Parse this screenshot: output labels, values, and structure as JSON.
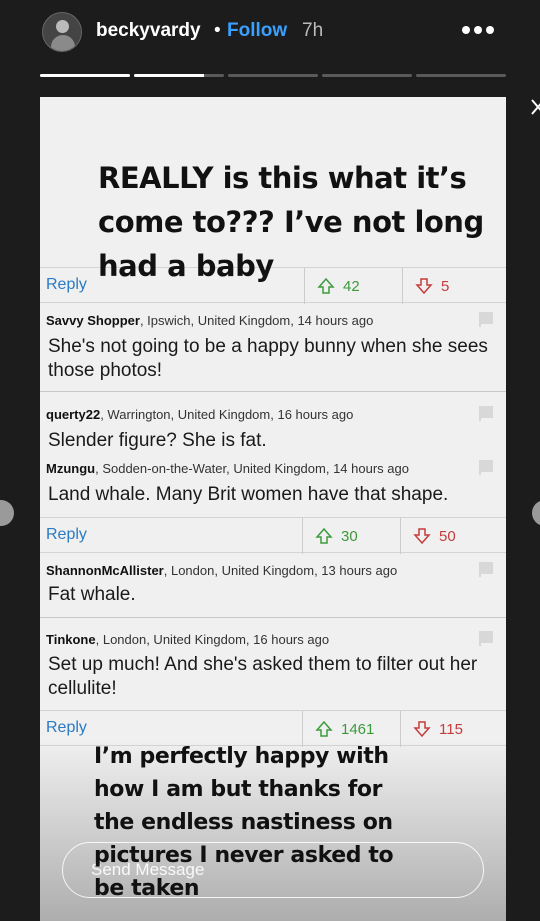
{
  "header": {
    "username": "beckyvardy",
    "separator": "•",
    "follow_label": "Follow",
    "time": "7h"
  },
  "story": {
    "progress_segments": [
      1.0,
      0.78,
      0.0,
      0.0,
      0.0
    ],
    "caption_top": "REALLY is this what it’s come to??? I’ve not long had a baby",
    "caption_bottom": "I’m perfectly happy with how I am but thanks for the endless nastiness on pictures I never asked to be taken"
  },
  "screenshot": {
    "vote_rows": [
      {
        "reply": "Reply",
        "up": "42",
        "down": "5"
      },
      {
        "reply": "Reply",
        "up": "30",
        "down": "50"
      },
      {
        "reply": "Reply",
        "up": "1461",
        "down": "115"
      }
    ],
    "comments": [
      {
        "user": "Savvy Shopper",
        "location": ", Ipswich, United Kingdom, 14 hours ago",
        "text": "She's not going to be a happy bunny when she sees those photos!"
      },
      {
        "user": "querty22",
        "location": ", Warrington, United Kingdom, 16 hours ago",
        "text": "Slender figure? She is fat."
      },
      {
        "user": "Mzungu",
        "location": ", Sodden-on-the-Water, United Kingdom, 14 hours ago",
        "text": "Land whale. Many Brit women have that shape."
      },
      {
        "user": "ShannonMcAllister",
        "location": ", London, United Kingdom, 13 hours ago",
        "text": "Fat whale."
      },
      {
        "user": "Tinkone",
        "location": ", London, United Kingdom, 16 hours ago",
        "text": "Set up much! And she's asked them to filter out her cellulite!"
      }
    ]
  },
  "footer": {
    "send_placeholder": "Send Message"
  },
  "colors": {
    "follow": "#3aa0ff",
    "upvote": "#3c9a3c",
    "downvote": "#c43c3c",
    "reply": "#2a7ac4"
  }
}
